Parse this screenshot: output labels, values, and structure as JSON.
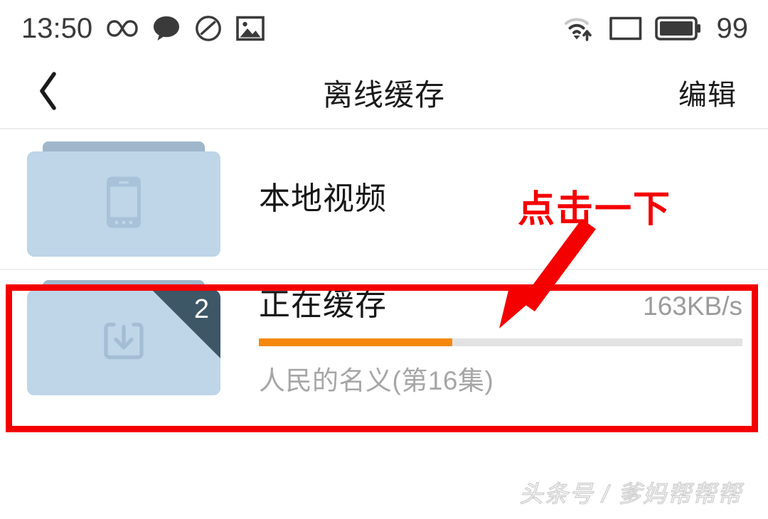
{
  "status_bar": {
    "time": "13:50",
    "battery_level": "99",
    "left_icons": [
      "infinity-icon",
      "chat-bubble-icon",
      "no-entry-icon",
      "image-icon"
    ],
    "right_icons": [
      "wifi-icon",
      "sim-card-icon",
      "battery-icon"
    ]
  },
  "nav_bar": {
    "back_icon": "chevron-left-icon",
    "title": "离线缓存",
    "action_label": "编辑"
  },
  "list": {
    "items": [
      {
        "id": "local-video",
        "title": "本地视频",
        "thumb_icon": "phone-icon",
        "badge": null,
        "speed": null,
        "subtitle": null,
        "progress_percent": null
      },
      {
        "id": "caching",
        "title": "正在缓存",
        "thumb_icon": "download-icon",
        "badge": "2",
        "speed": "163KB/s",
        "subtitle": "人民的名义(第16集)",
        "progress_percent": 40
      }
    ]
  },
  "annotation": {
    "text": "点击一下",
    "arrow_icon": "arrow-down-left-icon",
    "color": "#f40000",
    "target_item_id": "caching"
  },
  "watermark": {
    "text": "头条号 / 爹妈帮帮帮"
  },
  "colors": {
    "accent_orange": "#f5870d",
    "annotation_red": "#f40000",
    "folder_body": "#bfd5e8",
    "folder_tab": "#9fb6cb",
    "badge": "#3e5767",
    "text_primary": "#171717",
    "text_secondary": "#a6a6a6"
  }
}
